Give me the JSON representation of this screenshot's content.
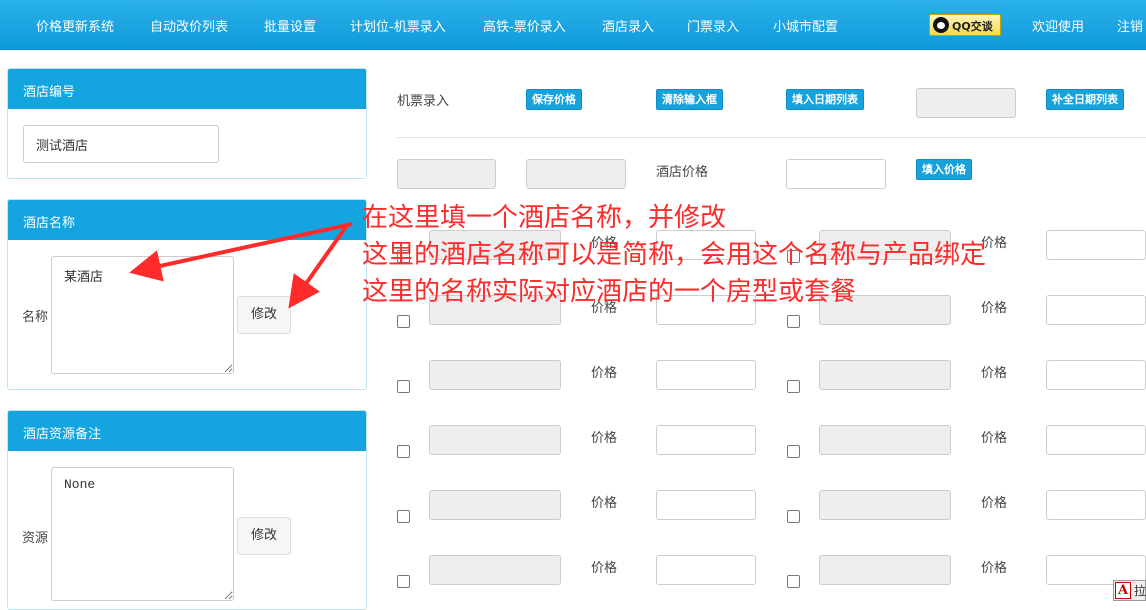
{
  "nav": {
    "items": [
      "价格更新系统",
      "自动改价列表",
      "批量设置",
      "计划位-机票录入",
      "高铁-票价录入",
      "酒店录入",
      "门票录入",
      "小城市配置"
    ],
    "qq_label": "QQ交谈",
    "welcome": "欢迎使用",
    "logout": "注销"
  },
  "panels": {
    "hotel_code": {
      "title": "酒店编号",
      "value": "测试酒店"
    },
    "hotel_name": {
      "title": "酒店名称",
      "label": "名称",
      "value": "某酒店",
      "button": "修改"
    },
    "resource_note": {
      "title": "酒店资源备注",
      "label": "资源",
      "value": "None",
      "button": "修改"
    }
  },
  "toolbar": {
    "flight_entry_label": "机票录入",
    "save_price": "保存价格",
    "clear_inputs": "清除输入框",
    "fill_date_list": "填入日期列表",
    "fill_all_dates": "补全日期列表",
    "hotel_price_label": "酒店价格",
    "fill_price": "填入价格"
  },
  "grid": {
    "price_label": "价格",
    "rows": 6
  },
  "annotation": {
    "line1": "在这里填一个酒店名称，并修改",
    "line2": "这里的酒店名称可以是简称，会用这个名称与产品绑定",
    "line3": "这里的名称实际对应酒店的一个房型或套餐"
  },
  "corner": {
    "letter": "A",
    "text": "拉"
  },
  "colors": {
    "nav_bg": "#14a4e0",
    "annotation": "#ff2a2a",
    "button_blue": "#17a2dc"
  }
}
